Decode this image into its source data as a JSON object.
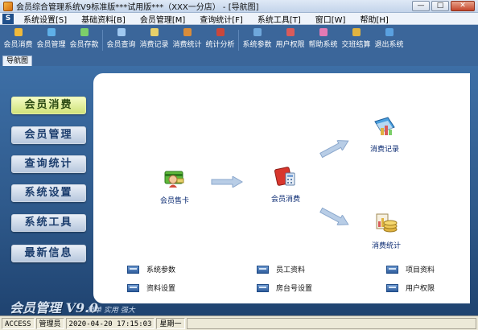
{
  "window": {
    "title": "会员综合管理系统V9标准版***试用版***（XXX一分店） - [导航图]",
    "buttons": [
      "—",
      "□",
      "✕"
    ]
  },
  "menubar": [
    {
      "label": "系统设置[S]"
    },
    {
      "label": "基础资料[B]"
    },
    {
      "label": "会员管理[M]"
    },
    {
      "label": "查询统计[F]"
    },
    {
      "label": "系统工具[T]"
    },
    {
      "label": "窗口[W]"
    },
    {
      "label": "帮助[H]"
    }
  ],
  "toolbar": {
    "groups": [
      [
        {
          "label": "会员消费",
          "icon": "member-consume-icon",
          "color": "#f0b93a"
        },
        {
          "label": "会员管理",
          "icon": "member-manage-icon",
          "color": "#5fb0e8"
        },
        {
          "label": "会员存款",
          "icon": "member-deposit-icon",
          "color": "#7ccf6a"
        }
      ],
      [
        {
          "label": "会员查询",
          "icon": "member-search-icon",
          "color": "#9fc8f0"
        },
        {
          "label": "消费记录",
          "icon": "consume-record-icon",
          "color": "#e6d06a"
        },
        {
          "label": "消费统计",
          "icon": "consume-stats-icon",
          "color": "#d98c3a"
        },
        {
          "label": "统计分析",
          "icon": "stats-analysis-icon",
          "color": "#c9473c"
        }
      ],
      [
        {
          "label": "系统参数",
          "icon": "system-params-icon",
          "color": "#6fa8dc"
        },
        {
          "label": "用户权限",
          "icon": "user-permission-icon",
          "color": "#d95b5b"
        },
        {
          "label": "帮助系统",
          "icon": "help-icon",
          "color": "#e27ab4"
        },
        {
          "label": "交班结算",
          "icon": "shift-settle-icon",
          "color": "#e0b340"
        },
        {
          "label": "退出系统",
          "icon": "exit-icon",
          "color": "#5aa1e0"
        }
      ]
    ]
  },
  "tab": {
    "label": "导航图"
  },
  "nav": {
    "items": [
      "会员消费",
      "会员管理",
      "查询统计",
      "系统设置",
      "系统工具",
      "最新信息"
    ],
    "active": 0
  },
  "brand": {
    "text": "会员管理 V9.0",
    "tagline": "简单 实用 强大"
  },
  "diagram": {
    "sell_card": {
      "label": "会员售卡",
      "icon": "member-card-icon"
    },
    "consume": {
      "label": "会员消费",
      "icon": "wallet-calculator-icon"
    },
    "record": {
      "label": "消费记录",
      "icon": "record-book-icon"
    },
    "stats": {
      "label": "消费统计",
      "icon": "coins-chart-icon"
    }
  },
  "quicklinks": [
    {
      "label": "系统参数"
    },
    {
      "label": "员工资料"
    },
    {
      "label": "项目资料"
    },
    {
      "label": "资料设置"
    },
    {
      "label": "房台号设置"
    },
    {
      "label": "用户权限"
    }
  ],
  "statusbar": {
    "db": "ACCESS",
    "user": "管理员",
    "datetime": "2020-04-20 17:15:03",
    "weekday": "星期一"
  },
  "colors": {
    "toolbar_bg": "#3b669a",
    "nav_active": "#cfe27a",
    "link_text": "#0a2a72"
  }
}
